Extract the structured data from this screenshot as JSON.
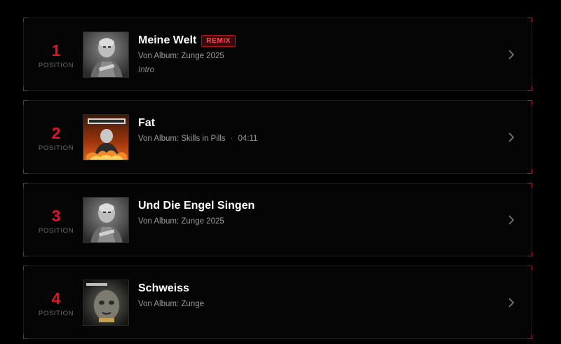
{
  "position_label": "POSITION",
  "tracks": [
    {
      "position": "1",
      "title": "Meine Welt",
      "badge": "REMIX",
      "album": "Von Album: Zunge 2025",
      "duration": "",
      "note": "Intro",
      "cover": "zunge-2025-cover"
    },
    {
      "position": "2",
      "title": "Fat",
      "badge": "",
      "album": "Von Album: Skills in Pills",
      "duration": "04:11",
      "note": "",
      "cover": "skills-in-pills-cover"
    },
    {
      "position": "3",
      "title": "Und Die Engel Singen",
      "badge": "",
      "album": "Von Album: Zunge 2025",
      "duration": "",
      "note": "",
      "cover": "zunge-2025-cover"
    },
    {
      "position": "4",
      "title": "Schweiss",
      "badge": "",
      "album": "Von Album: Zunge",
      "duration": "",
      "note": "",
      "cover": "zunge-cover"
    }
  ],
  "colors": {
    "accent": "#e01427",
    "background": "#000000"
  },
  "icons": {
    "row_action": "chevron-right-icon"
  }
}
